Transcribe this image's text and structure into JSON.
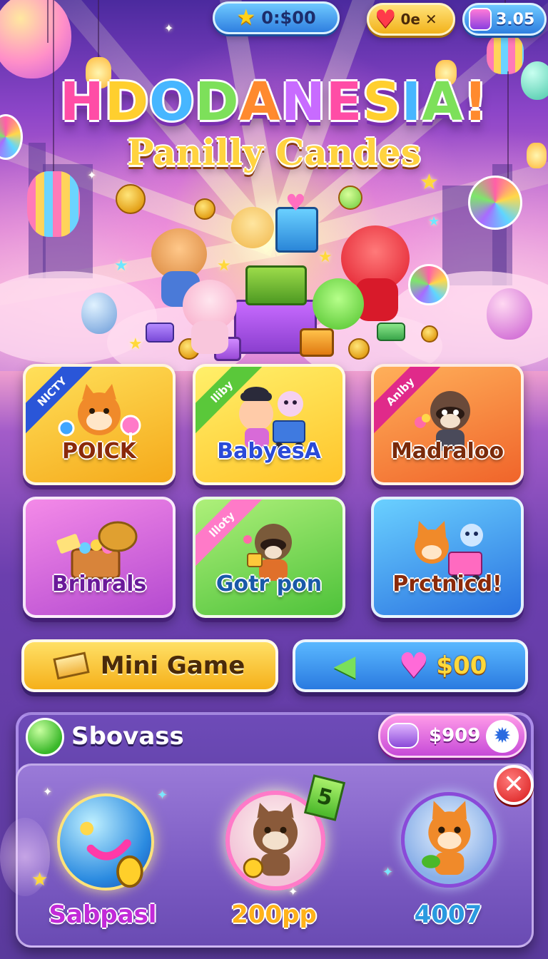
{
  "hud": {
    "coins_value": "0:$00",
    "lives_value": "0e ✕",
    "gems_value": "3.05"
  },
  "title": {
    "main": "HDODANESIA!",
    "sub": "Panilly Candes"
  },
  "modes": [
    {
      "ribbon": "NICTY",
      "label": "POICK",
      "color": "#ffc83a"
    },
    {
      "ribbon": "lliby",
      "label": "BabyesA",
      "color": "#ffd44a"
    },
    {
      "ribbon": "Anlby",
      "label": "Madraloo",
      "color": "#ff8a3a"
    },
    {
      "ribbon": "",
      "label": "Brinrals",
      "color": "#e06ad6"
    },
    {
      "ribbon": "llloty",
      "label": "Gotr pon",
      "color": "#7ed84f"
    },
    {
      "ribbon": "",
      "label": "Prctnicd!",
      "color": "#3fa6ff"
    }
  ],
  "actions": {
    "mini_game_label": "Mini Game",
    "hearts_value": "$00"
  },
  "panel": {
    "title": "Sbovass",
    "currency_value": "$909",
    "rewards": [
      {
        "label": "Sabpasl"
      },
      {
        "label": "200pp",
        "tag": "5"
      },
      {
        "label": "4007"
      }
    ]
  }
}
